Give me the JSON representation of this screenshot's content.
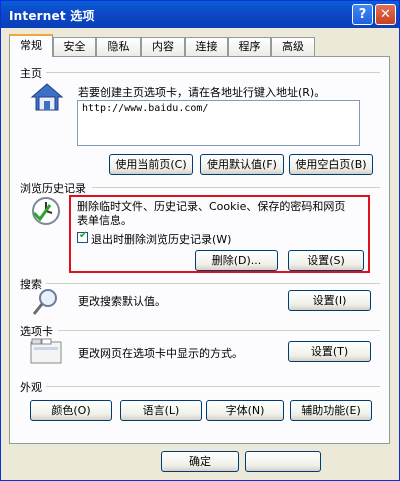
{
  "window": {
    "title": "Internet 选项",
    "help_glyph": "?",
    "close_glyph": "✕"
  },
  "tabs": [
    {
      "label": "常规",
      "active": true
    },
    {
      "label": "安全",
      "active": false
    },
    {
      "label": "隐私",
      "active": false
    },
    {
      "label": "内容",
      "active": false
    },
    {
      "label": "连接",
      "active": false
    },
    {
      "label": "程序",
      "active": false
    },
    {
      "label": "高级",
      "active": false
    }
  ],
  "homepage": {
    "heading": "主页",
    "description": "若要创建主页选项卡，请在各地址行键入地址(R)。",
    "url": "http://www.baidu.com/",
    "use_current": "使用当前页(C)",
    "use_default": "使用默认值(F)",
    "use_blank": "使用空白页(B)"
  },
  "history": {
    "heading": "浏览历史记录",
    "description_line1": "删除临时文件、历史记录、Cookie、保存的密码和网页",
    "description_line2": "表单信息。",
    "checkbox_label": "退出时删除浏览历史记录(W)",
    "checkbox_checked": true,
    "delete_button": "删除(D)...",
    "settings_button": "设置(S)"
  },
  "search": {
    "heading": "搜索",
    "description": "更改搜索默认值。",
    "settings_button": "设置(I)"
  },
  "tabs_section": {
    "heading": "选项卡",
    "description": "更改网页在选项卡中显示的方式。",
    "settings_button": "设置(T)"
  },
  "appearance": {
    "heading": "外观",
    "colors_button": "颜色(O)",
    "languages_button": "语言(L)",
    "fonts_button": "字体(N)",
    "accessibility_button": "辅助功能(E)"
  },
  "footer": {
    "ok_button": "确定"
  },
  "colors": {
    "title_bar": "#0a53d0",
    "highlight": "#e0101a",
    "tab_accent": "#f0a63a"
  }
}
